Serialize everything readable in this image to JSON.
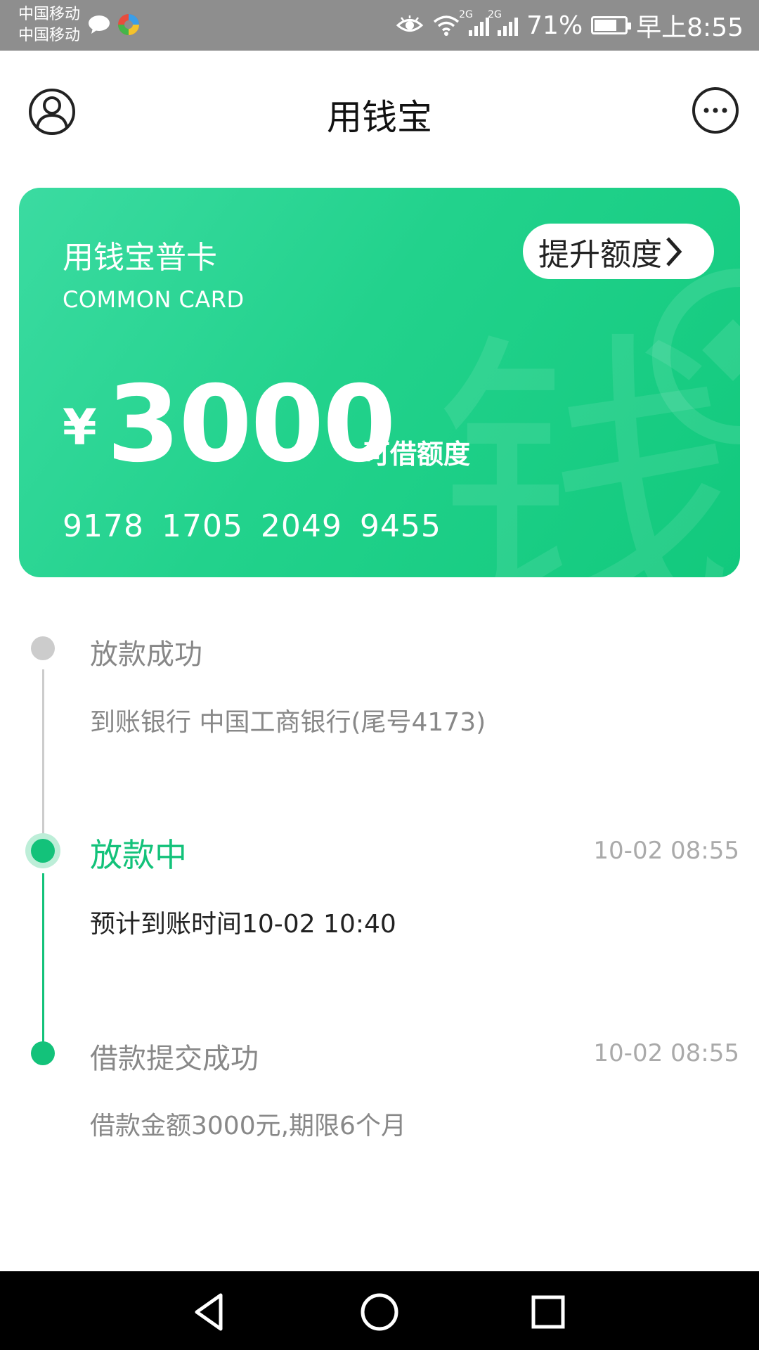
{
  "status_bar": {
    "carrier_1": "中国移动",
    "carrier_2": "中国移动",
    "network_1": "2G",
    "network_2": "2G",
    "battery": "71%",
    "battery_level": 0.71,
    "time": "早上8:55"
  },
  "header": {
    "title": "用钱宝",
    "left_icon": "user-profile-icon",
    "right_icon": "more-options-icon"
  },
  "card": {
    "name": "用钱宝普卡",
    "subtitle": "COMMON CARD",
    "raise_button": "提升额度",
    "currency": "¥",
    "amount": "3000",
    "amount_label": "可借额度",
    "number": "9178  1705  2049  9455",
    "background_glyph": "钱",
    "colors": {
      "start": "#3bdba1",
      "end": "#12c97d"
    }
  },
  "timeline": {
    "accent_color": "#13c27a",
    "inactive_color": "#cccccc",
    "steps": [
      {
        "title": "放款成功",
        "time": "",
        "desc": "到账银行 中国工商银行(尾号4173)",
        "state": "pending"
      },
      {
        "title": "放款中",
        "time": "10-02 08:55",
        "desc": "预计到账时间10-02 10:40",
        "state": "current"
      },
      {
        "title": "借款提交成功",
        "time": "10-02 08:55",
        "desc": "借款金额3000元,期限6个月",
        "state": "done"
      }
    ]
  },
  "nav_bar": {
    "back_icon": "back-triangle-icon",
    "home_icon": "home-circle-icon",
    "recents_icon": "recents-square-icon"
  }
}
